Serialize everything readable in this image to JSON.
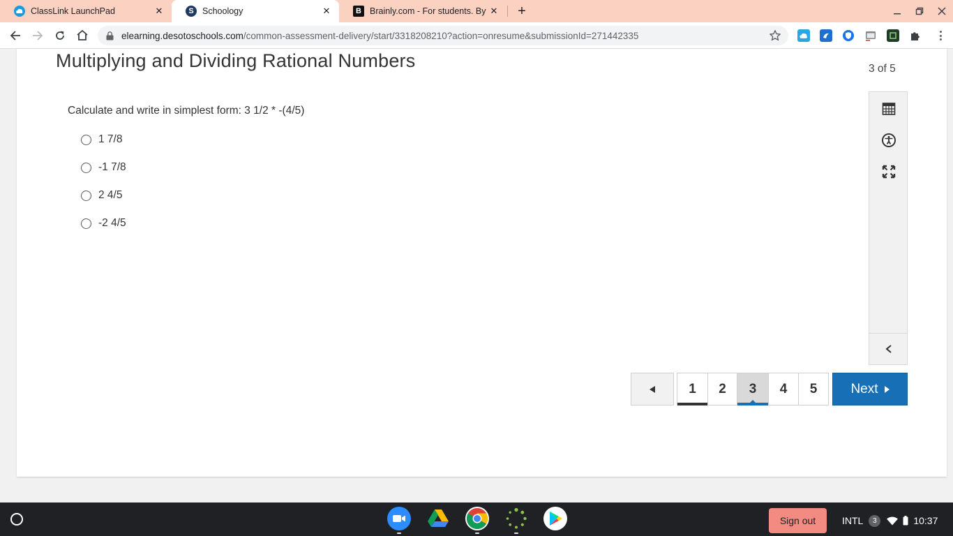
{
  "browser": {
    "tabs": [
      {
        "title": "ClassLink LaunchPad",
        "active": false
      },
      {
        "title": "Schoology",
        "active": true
      },
      {
        "title": "Brainly.com - For students. By students.",
        "active": false
      }
    ],
    "address": {
      "host": "elearning.desotoschools.com",
      "path": "/common-assessment-delivery/start/3318208210?action=onresume&submissionId=271442335"
    }
  },
  "assessment": {
    "title": "Multiplying and Dividing Rational Numbers",
    "progress": "3 of 5",
    "question": "Calculate and write in simplest form: 3 1/2 * -(4/5)",
    "choices": [
      "1 7/8",
      "-1 7/8",
      "2 4/5",
      "-2 4/5"
    ],
    "pages": [
      "1",
      "2",
      "3",
      "4",
      "5"
    ],
    "current_page": 3,
    "next_label": "Next"
  },
  "shelf": {
    "sign_out": "Sign out",
    "input_method": "INTL",
    "notification_count": "3",
    "time": "10:37"
  },
  "colors": {
    "tabstrip": "#fbd2c2",
    "accent_blue": "#1770b5",
    "signout": "#f28b82",
    "shelf": "#202124"
  }
}
